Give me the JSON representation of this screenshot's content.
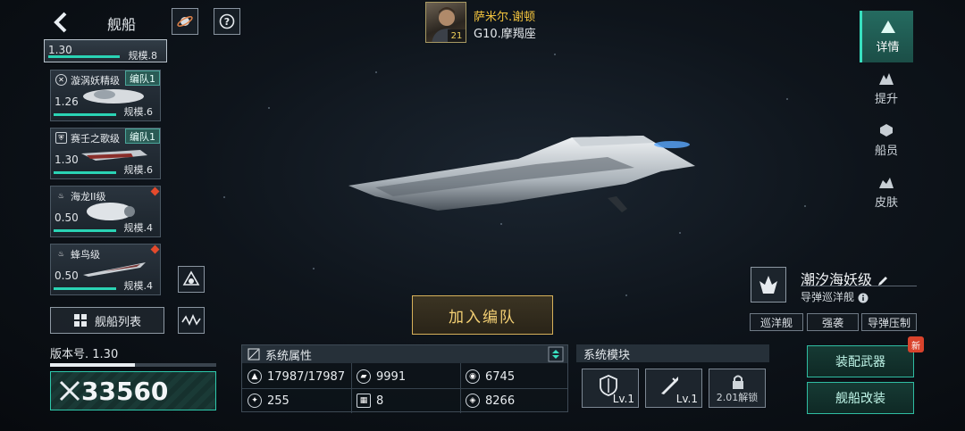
{
  "header": {
    "title": "舰船"
  },
  "captain": {
    "name": "萨米尔.谢顿",
    "sub": "G10.摩羯座",
    "level": "21"
  },
  "ships": {
    "top": {
      "version": "1.30",
      "scale": "规模.8"
    },
    "items": [
      {
        "name": "漩涡妖精级",
        "badge": "编队1",
        "version": "1.26",
        "scale": "规模.6",
        "alert": false
      },
      {
        "name": "赛壬之歌级",
        "badge": "编队1",
        "version": "1.30",
        "scale": "规模.6",
        "alert": false
      },
      {
        "name": "海龙II级",
        "badge": "",
        "version": "0.50",
        "scale": "规模.4",
        "alert": true
      },
      {
        "name": "蜂鸟级",
        "badge": "",
        "version": "0.50",
        "scale": "规模.4",
        "alert": true
      }
    ],
    "list_button": "舰船列表"
  },
  "tabs": [
    {
      "label": "详情",
      "icon": "details-icon",
      "active": true
    },
    {
      "label": "提升",
      "icon": "upgrade-icon",
      "active": false
    },
    {
      "label": "船员",
      "icon": "crew-icon",
      "active": false
    },
    {
      "label": "皮肤",
      "icon": "skin-icon",
      "active": false
    }
  ],
  "ship": {
    "name": "潮汐海妖级",
    "type": "导弹巡洋舰",
    "tags": [
      "巡洋舰",
      "强袭",
      "导弹压制"
    ]
  },
  "join_button": "加入编队",
  "version": {
    "label": "版本号. 1.30",
    "progress": 0.5
  },
  "power": "33560",
  "attributes": {
    "title": "系统属性",
    "cells": [
      {
        "icon": "hull-icon",
        "value": "17987/17987"
      },
      {
        "icon": "armor-icon",
        "value": "9991"
      },
      {
        "icon": "shield-icon",
        "value": "6745"
      },
      {
        "icon": "speed-icon",
        "value": "255"
      },
      {
        "icon": "energy-icon",
        "value": "8"
      },
      {
        "icon": "target-icon",
        "value": "8266"
      }
    ]
  },
  "modules": {
    "title": "系统模块",
    "items": [
      {
        "icon": "shield-module-icon",
        "level": "Lv.1"
      },
      {
        "icon": "missile-module-icon",
        "level": "Lv.1"
      },
      {
        "icon": "lock-icon",
        "unlock": "2.01解锁"
      }
    ]
  },
  "actions": {
    "equip": "装配武器",
    "refit": "舰船改装",
    "new_badge": "新"
  },
  "colors": {
    "accent": "#2ec9ac",
    "gold": "#f3c43e",
    "alert": "#e44a2c"
  }
}
